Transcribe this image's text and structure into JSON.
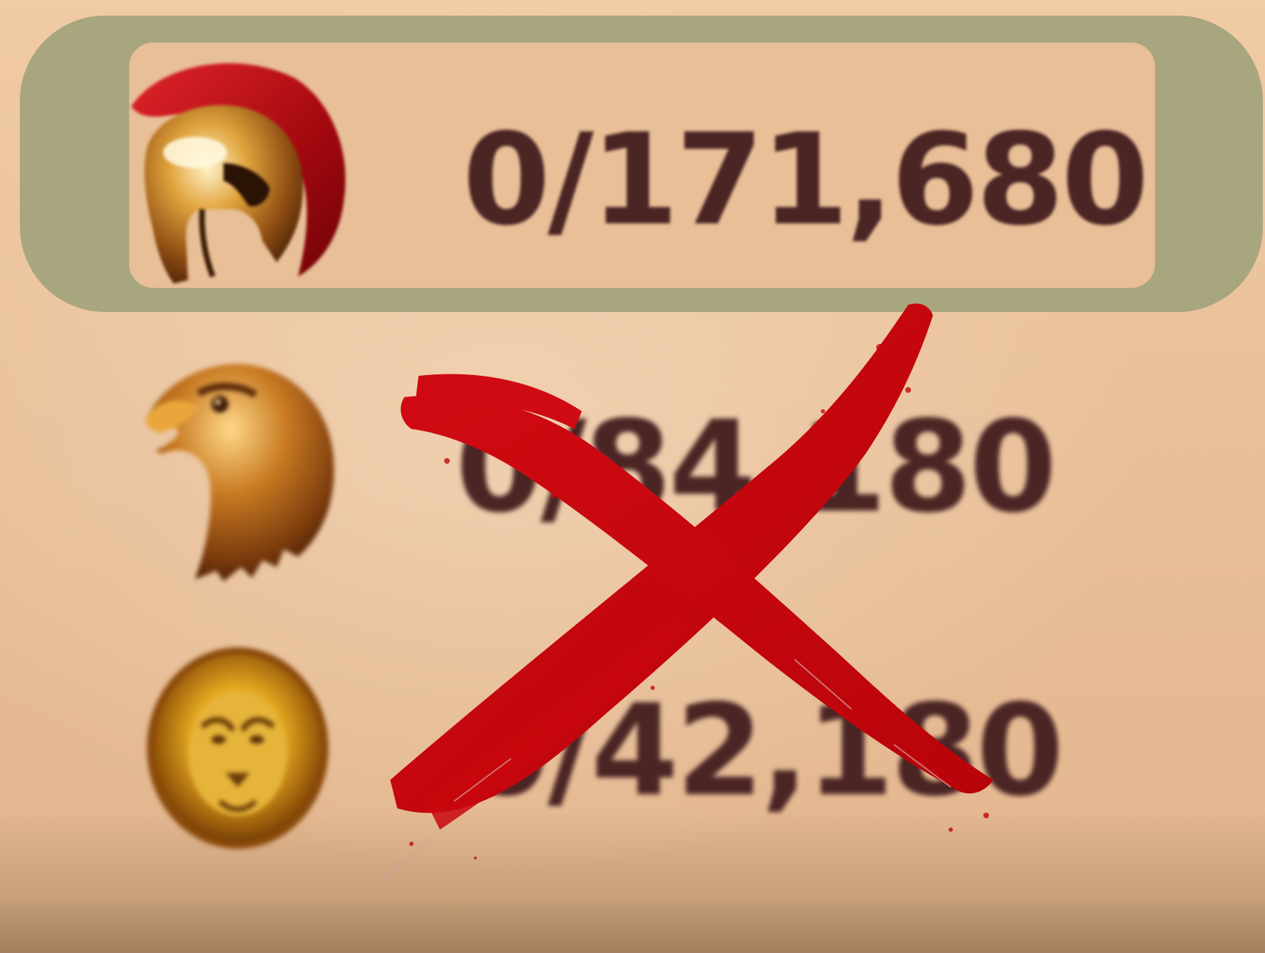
{
  "resources": [
    {
      "icon": "spartan-helmet-icon",
      "value": "0/171,680",
      "highlighted": true
    },
    {
      "icon": "eagle-head-icon",
      "value": "0/84,180",
      "highlighted": false
    },
    {
      "icon": "lion-head-icon",
      "value": "0/42,180",
      "highlighted": false
    }
  ],
  "colors": {
    "panel": "#e8bf97",
    "highlight": "#a8a67f",
    "text": "#4b2424",
    "x_mark": "#c4070c"
  }
}
